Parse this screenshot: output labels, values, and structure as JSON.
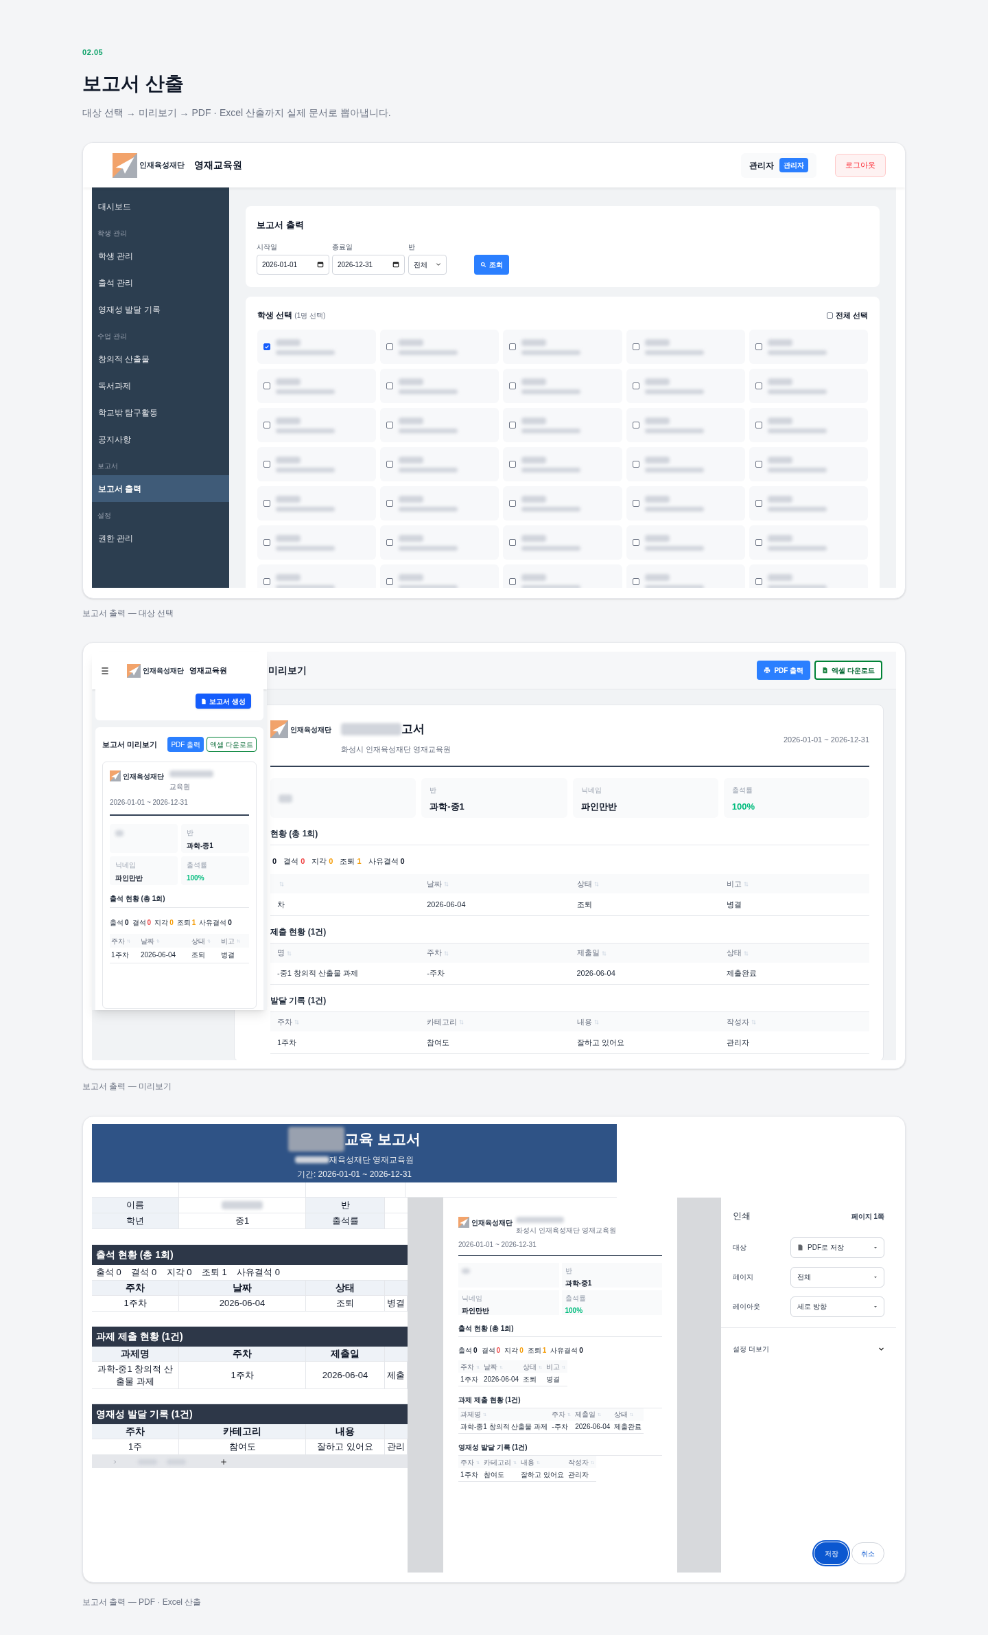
{
  "section_number": "02.05",
  "title": "보고서 산출",
  "subtitle": "대상 선택 → 미리보기 → PDF · Excel 산출까지 실제 문서로 뽑아냅니다.",
  "target_selection": {
    "caption": "보고서 출력 — 대상 선택",
    "header": {
      "logo_text": "인재육성재단",
      "org": "영재교육원",
      "user": "관리자",
      "role": "관리자",
      "logout": "로그아웃"
    },
    "sidebar": [
      {
        "kind": "item",
        "label": "대시보드",
        "selected": false
      },
      {
        "kind": "section",
        "label": "학생 관리"
      },
      {
        "kind": "item",
        "label": "학생 관리",
        "selected": false
      },
      {
        "kind": "item",
        "label": "출석 관리",
        "selected": false
      },
      {
        "kind": "item",
        "label": "영재성 발달 기록",
        "selected": false
      },
      {
        "kind": "section",
        "label": "수업 관리"
      },
      {
        "kind": "item",
        "label": "창의적 산출물",
        "selected": false
      },
      {
        "kind": "item",
        "label": "독서과제",
        "selected": false
      },
      {
        "kind": "item",
        "label": "학교밖 탐구활동",
        "selected": false
      },
      {
        "kind": "item",
        "label": "공지사항",
        "selected": false
      },
      {
        "kind": "section",
        "label": "보고서"
      },
      {
        "kind": "item",
        "label": "보고서 출력",
        "selected": true
      },
      {
        "kind": "section",
        "label": "설정"
      },
      {
        "kind": "item",
        "label": "권한 관리",
        "selected": false
      }
    ],
    "form": {
      "title": "보고서 출력",
      "start_label": "시작일",
      "start": "2026-01-01",
      "end_label": "종료일",
      "end": "2026-12-31",
      "class_label": "반",
      "class": "전체",
      "button": "조회"
    },
    "students": {
      "title": "학생 선택",
      "count": "(1명 선택)",
      "select_all": {
        "label": "전체 선택",
        "checked": false
      },
      "cards": [
        {
          "checked": true
        },
        {
          "checked": false
        },
        {
          "checked": false
        },
        {
          "checked": false
        },
        {
          "checked": false
        },
        {
          "checked": false
        },
        {
          "checked": false
        },
        {
          "checked": false
        },
        {
          "checked": false
        },
        {
          "checked": false
        },
        {
          "checked": false
        },
        {
          "checked": false
        },
        {
          "checked": false
        },
        {
          "checked": false
        },
        {
          "checked": false
        },
        {
          "checked": false
        },
        {
          "checked": false
        },
        {
          "checked": false
        },
        {
          "checked": false
        },
        {
          "checked": false
        },
        {
          "checked": false
        },
        {
          "checked": false
        },
        {
          "checked": false
        },
        {
          "checked": false
        },
        {
          "checked": false
        },
        {
          "checked": false
        },
        {
          "checked": false
        },
        {
          "checked": false
        },
        {
          "checked": false
        },
        {
          "checked": false
        },
        {
          "checked": false
        },
        {
          "checked": false
        },
        {
          "checked": false
        },
        {
          "checked": false
        },
        {
          "checked": false
        }
      ]
    }
  },
  "preview": {
    "caption": "보고서 출력 — 미리보기",
    "desktop": {
      "title": "미리보기",
      "pdf_button": "PDF 출력",
      "excel_button": "엑셀 다운로드",
      "report": {
        "logo_text": "인재육성재단",
        "title": "고서",
        "org": "화성시 인재육성재단 영재교육원",
        "period": "2026-01-01 ~ 2026-12-31",
        "info": [
          {
            "kind": "redacted"
          },
          {
            "kind": "field",
            "label": "반",
            "value": "과학-중1",
            "emphasis": false
          },
          {
            "kind": "field",
            "label": "닉네임",
            "value": "파인만반",
            "emphasis": false
          },
          {
            "kind": "field",
            "label": "출석률",
            "value": "100%",
            "emphasis": true
          }
        ],
        "sections": [
          {
            "title": "현황 (총 1회)",
            "stats": [
              {
                "value": "0",
                "color": "#111827"
              },
              {
                "label": "결석",
                "value": "0",
                "color": "#ef4444"
              },
              {
                "label": "지각",
                "value": "0",
                "color": "#f59e0b"
              },
              {
                "label": "조퇴",
                "value": "1",
                "color": "#f59e0b"
              },
              {
                "label": "사유결석",
                "value": "0",
                "color": "#111827"
              }
            ],
            "columns": [
              {
                "sortable": true
              },
              {
                "label": "날짜",
                "sortable": true
              },
              {
                "label": "상태",
                "sortable": true
              },
              {
                "label": "비고",
                "sortable": true
              }
            ],
            "rows": [
              [
                "차",
                "2026-06-04",
                "조퇴",
                "병결"
              ]
            ]
          },
          {
            "title": "제출 현황 (1건)",
            "columns": [
              {
                "label": "명",
                "sortable": true
              },
              {
                "label": "주차",
                "sortable": true
              },
              {
                "label": "제출일",
                "sortable": true
              },
              {
                "label": "상태",
                "sortable": true
              }
            ],
            "rows": [
              [
                "-중1 창의적 산출물 과제",
                "-주차",
                "2026-06-04",
                "제출완료"
              ]
            ]
          },
          {
            "title": "발달 기록 (1건)",
            "columns": [
              {
                "label": "주차",
                "sortable": true
              },
              {
                "label": "카테고리",
                "sortable": true
              },
              {
                "label": "내용",
                "sortable": true
              },
              {
                "label": "작성자",
                "sortable": true
              }
            ],
            "rows": [
              [
                "1주차",
                "참여도",
                "잘하고 있어요",
                "관리자"
              ]
            ]
          }
        ]
      }
    },
    "mobile": {
      "logo_text": "인재육성재단",
      "org": "영재교육원",
      "generate_button": "보고서 생성",
      "title": "보고서 미리보기",
      "pdf_button": "PDF 출력",
      "excel_button": "엑셀 다운로드",
      "report": {
        "logo_text": "인재육성재단",
        "org": "교육원",
        "period": "2026-01-01 ~ 2026-12-31",
        "info": [
          {
            "kind": "redacted"
          },
          {
            "kind": "field",
            "label": "반",
            "value": "과학-중1",
            "emphasis": false
          },
          {
            "kind": "field",
            "label": "닉네임",
            "value": "파인만반",
            "emphasis": false
          },
          {
            "kind": "field",
            "label": "출석률",
            "value": "100%",
            "emphasis": true
          }
        ],
        "sections": [
          {
            "title": "출석 현황 (총 1회)",
            "stats": [
              {
                "label": "출석",
                "value": "0",
                "color": "#111827"
              },
              {
                "label": "결석",
                "value": "0",
                "color": "#ef4444"
              },
              {
                "label": "지각",
                "value": "0",
                "color": "#f59e0b"
              },
              {
                "label": "조퇴",
                "value": "1",
                "color": "#f59e0b"
              },
              {
                "label": "사유결석",
                "value": "0",
                "color": "#111827"
              }
            ],
            "columns": [
              {
                "label": "주차",
                "sortable": true
              },
              {
                "label": "날짜",
                "sortable": true
              },
              {
                "label": "상태",
                "sortable": true
              },
              {
                "label": "비고",
                "sortable": true
              }
            ],
            "rows": [
              [
                "1주차",
                "2026-06-04",
                "조퇴",
                "병결"
              ]
            ]
          }
        ]
      }
    }
  },
  "export": {
    "caption": "보고서 출력 — PDF · Excel 산출",
    "sheet": {
      "title": "교육 보고서",
      "org": "재육성재단 영재교육원",
      "period": "기간: 2026-01-01 ~ 2026-12-31",
      "info_rows": [
        [
          {
            "kind": "label",
            "text": "이름"
          },
          {
            "kind": "redacted"
          },
          {
            "kind": "label",
            "text": "반"
          }
        ],
        [
          {
            "kind": "label",
            "text": "학년"
          },
          {
            "kind": "value",
            "text": "중1"
          },
          {
            "kind": "label",
            "text": "출석률"
          }
        ]
      ],
      "sections": [
        {
          "title": "출석 현황 (총 1회)",
          "summary": "출석 0    결석 0    지각 0    조퇴 1    사유결석 0",
          "columns": [
            "주차",
            "날짜",
            "상태"
          ],
          "rows": [
            [
              "1주차",
              "2026-06-04",
              "조퇴",
              "병결"
            ]
          ]
        },
        {
          "title": "과제 제출 현황 (1건)",
          "columns": [
            "과제명",
            "주차",
            "제출일"
          ],
          "rows": [
            [
              "과학-중1 창의적 산출물 과제",
              "1주차",
              "2026-06-04",
              "제출"
            ]
          ]
        },
        {
          "title": "영재성 발달 기록 (1건)",
          "columns": [
            "주차",
            "카테고리",
            "내용"
          ],
          "rows": [
            [
              "1주",
              "참여도",
              "잘하고 있어요",
              "관리"
            ]
          ]
        }
      ]
    },
    "print_dialog": {
      "title": "인쇄",
      "pages": "페이지 1쪽",
      "settings": [
        {
          "kind": "file",
          "label": "대상",
          "value": "PDF로 저장"
        },
        {
          "kind": "plain",
          "label": "페이지",
          "value": "전체"
        },
        {
          "kind": "plain",
          "label": "레이아웃",
          "value": "세로 방향"
        }
      ],
      "more": "설정 더보기",
      "save": "저장",
      "cancel": "취소",
      "report": {
        "logo_text": "인재육성재단",
        "org": "화성시 인재육성재단 영재교육원",
        "period": "2026-01-01 ~ 2026-12-31",
        "info": [
          {
            "kind": "redacted"
          },
          {
            "kind": "field",
            "label": "반",
            "value": "과학-중1",
            "emphasis": false
          },
          {
            "kind": "field",
            "label": "닉네임",
            "value": "파인만반",
            "emphasis": false
          },
          {
            "kind": "field",
            "label": "출석률",
            "value": "100%",
            "emphasis": true
          }
        ],
        "sections": [
          {
            "title": "출석 현황 (총 1회)",
            "stats": [
              {
                "label": "출석",
                "value": "0",
                "color": "#111827"
              },
              {
                "label": "결석",
                "value": "0",
                "color": "#ef4444"
              },
              {
                "label": "지각",
                "value": "0",
                "color": "#f59e0b"
              },
              {
                "label": "조퇴",
                "value": "1",
                "color": "#f59e0b"
              },
              {
                "label": "사유결석",
                "value": "0",
                "color": "#111827"
              }
            ],
            "columns": [
              {
                "label": "주차",
                "sortable": true
              },
              {
                "label": "날짜",
                "sortable": true
              },
              {
                "label": "상태",
                "sortable": true
              },
              {
                "label": "비고",
                "sortable": true
              }
            ],
            "rows": [
              [
                "1주차",
                "2026-06-04",
                "조퇴",
                "병결"
              ]
            ]
          },
          {
            "title": "과제 제출 현황 (1건)",
            "columns": [
              {
                "label": "과제명",
                "sortable": true
              },
              {
                "label": "주차",
                "sortable": true
              },
              {
                "label": "제출일",
                "sortable": true
              },
              {
                "label": "상태",
                "sortable": true
              }
            ],
            "rows": [
              [
                "과학-중1 창의적 산출물 과제",
                "-주차",
                "2026-06-04",
                "제출완료"
              ]
            ]
          },
          {
            "title": "영재성 발달 기록 (1건)",
            "columns": [
              {
                "label": "주차",
                "sortable": true
              },
              {
                "label": "카테고리",
                "sortable": true
              },
              {
                "label": "내용",
                "sortable": true
              },
              {
                "label": "작성자",
                "sortable": true
              }
            ],
            "rows": [
              [
                "1주차",
                "참여도",
                "잘하고 있어요",
                "관리자"
              ]
            ]
          }
        ]
      }
    }
  }
}
